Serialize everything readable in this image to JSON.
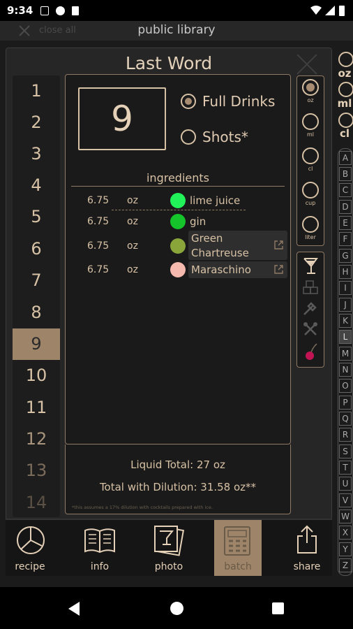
{
  "status_bar": {
    "time": "9:34"
  },
  "top_bar": {
    "close_all": "close all",
    "title": "public library"
  },
  "modal": {
    "title": "Last Word"
  },
  "servings": {
    "numbers": [
      "1",
      "2",
      "3",
      "4",
      "5",
      "6",
      "7",
      "8",
      "9",
      "10",
      "11",
      "12",
      "13",
      "14"
    ],
    "selected": "9",
    "display": "9"
  },
  "mode": {
    "options": [
      {
        "label": "Full Drinks",
        "selected": true
      },
      {
        "label": "Shots*",
        "selected": false
      }
    ]
  },
  "ingredients": {
    "heading": "ingredients",
    "rows": [
      {
        "amount": "6.75",
        "unit": "oz",
        "name": "lime juice",
        "color": "#22f25a",
        "link": false
      },
      {
        "amount": "6.75",
        "unit": "oz",
        "name": "gin",
        "color": "#14c42a",
        "link": false
      },
      {
        "amount": "6.75",
        "unit": "oz",
        "name": "Green Chartreuse",
        "name_line1": "Green",
        "name_line2": "Chartreuse",
        "color": "#8aa63a",
        "link": true
      },
      {
        "amount": "6.75",
        "unit": "oz",
        "name": "Maraschino",
        "color": "#f6b9ad",
        "link": true
      }
    ]
  },
  "totals": {
    "liquid": "Liquid Total: 27 oz",
    "dilution": "Total with Dilution: 31.58 oz**",
    "note": "*this assumes a 17% dilution with cocktails prepared with ice."
  },
  "units": {
    "options": [
      {
        "label": "oz",
        "selected": true
      },
      {
        "label": "ml",
        "selected": false
      },
      {
        "label": "cl",
        "selected": false
      },
      {
        "label": "cup",
        "selected": false
      },
      {
        "label": "liter",
        "selected": false
      }
    ]
  },
  "tools": [
    "glass-icon",
    "ice-icon",
    "shaker-icon",
    "tools-icon",
    "cherry-icon"
  ],
  "side_units": [
    "oz",
    "ml",
    "cl"
  ],
  "alphabet": [
    "A",
    "B",
    "C",
    "D",
    "E",
    "F",
    "G",
    "H",
    "I",
    "J",
    "K",
    "L",
    "M",
    "N",
    "O",
    "P",
    "Q",
    "R",
    "S",
    "T",
    "U",
    "V",
    "W",
    "X",
    "Y",
    "Z"
  ],
  "alphabet_selected": "L",
  "tabs": [
    {
      "label": "recipe",
      "icon": "pie-icon",
      "selected": false
    },
    {
      "label": "info",
      "icon": "book-icon",
      "selected": false
    },
    {
      "label": "photo",
      "icon": "photo-icon",
      "selected": false
    },
    {
      "label": "batch",
      "icon": "calculator-icon",
      "selected": true
    },
    {
      "label": "share",
      "icon": "share-icon",
      "selected": false
    }
  ],
  "colors": {
    "accent": "#9e8468",
    "text": "#d8c2a6",
    "panel": "#1a1a1a"
  }
}
